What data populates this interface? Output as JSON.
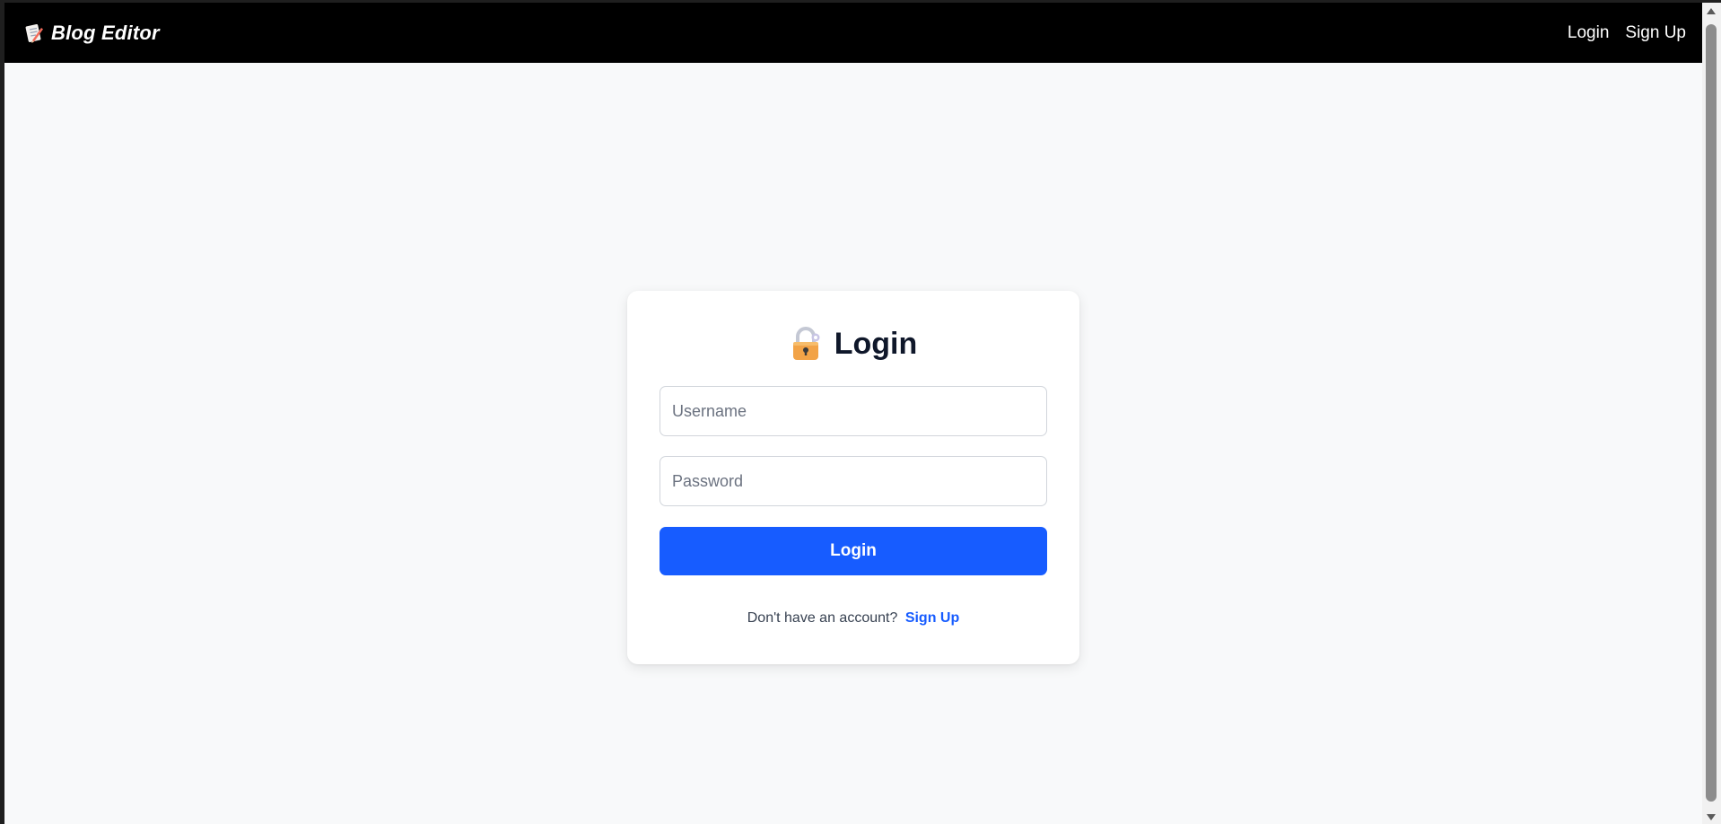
{
  "navbar": {
    "brand_icon": "memo-icon",
    "brand_text": "Blog Editor",
    "links": [
      "Login",
      "Sign Up"
    ]
  },
  "login_card": {
    "title_icon": "lock-icon",
    "title": "Login",
    "username_placeholder": "Username",
    "password_placeholder": "Password",
    "submit_label": "Login",
    "signup_prompt": "Don't have an account?",
    "signup_link": "Sign Up"
  },
  "colors": {
    "navbar_bg": "#000000",
    "page_bg": "#f8f9fa",
    "primary": "#175cff",
    "title_text": "#0f172a"
  }
}
